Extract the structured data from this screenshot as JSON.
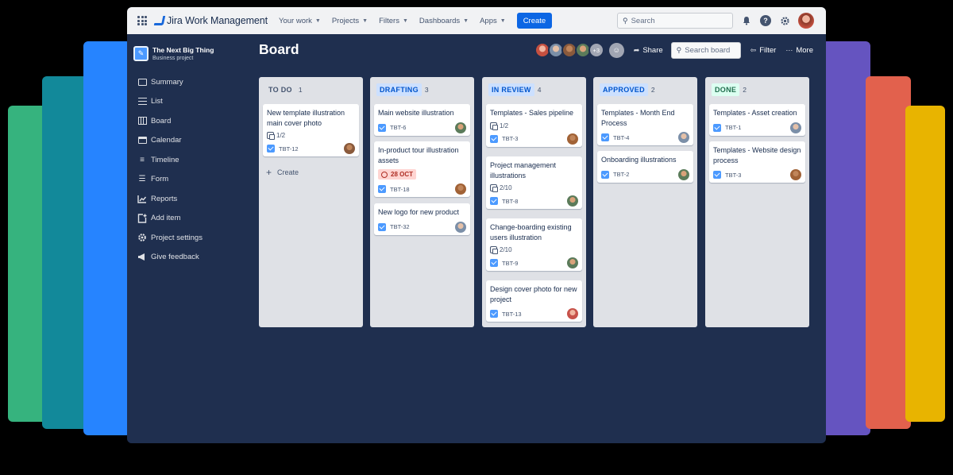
{
  "colors": {
    "stack": [
      "#36b37e",
      "#12899a",
      "#2684ff",
      "#6554c0",
      "#e2614d",
      "#f0502a",
      "#e8b400"
    ],
    "window_bg": "#1f2f4f",
    "accent": "#0c66e4",
    "avatars": [
      "#c55040",
      "#7b8fa8",
      "#8a5a3c",
      "#5b7b5a",
      "#9aa4b5",
      "#a16236",
      "#c7524a"
    ]
  },
  "topnav": {
    "logo_text": "Jira Work Management",
    "menu": [
      {
        "label": "Your work"
      },
      {
        "label": "Projects"
      },
      {
        "label": "Filters"
      },
      {
        "label": "Dashboards"
      },
      {
        "label": "Apps"
      }
    ],
    "create_label": "Create",
    "search_placeholder": "Search",
    "icons": [
      "grid-icon",
      "bell-icon",
      "help-icon",
      "gear-icon"
    ]
  },
  "sidebar": {
    "project_name": "The Next Big Thing",
    "project_type": "Business project",
    "items": [
      {
        "label": "Summary",
        "icon": "summary-icon"
      },
      {
        "label": "List",
        "icon": "list-icon"
      },
      {
        "label": "Board",
        "icon": "board-icon"
      },
      {
        "label": "Calendar",
        "icon": "calendar-icon"
      },
      {
        "label": "Timeline",
        "icon": "timeline-icon"
      },
      {
        "label": "Form",
        "icon": "form-icon"
      },
      {
        "label": "Reports",
        "icon": "reports-icon"
      },
      {
        "label": "Add item",
        "icon": "add-item-icon"
      },
      {
        "label": "Project settings",
        "icon": "gear-icon"
      },
      {
        "label": "Give feedback",
        "icon": "megaphone-icon"
      }
    ]
  },
  "board": {
    "title": "Board",
    "more_members": "+3",
    "share_label": "Share",
    "search_placeholder": "Search board",
    "filter_label": "Filter",
    "more_label": "More",
    "create_label": "Create",
    "columns": [
      {
        "name": "TO DO",
        "count": "1",
        "bg": "#dfe1e6",
        "fg": "#44546f",
        "cards": [
          {
            "title": "New template illustration main cover photo",
            "subtasks": "1/2",
            "key": "TBT-12"
          }
        ]
      },
      {
        "name": "DRAFTING",
        "count": "3",
        "bg": "#cce0ff",
        "fg": "#0055cc",
        "cards": [
          {
            "title": "Main website illustration",
            "key": "TBT-6"
          },
          {
            "title": "In-product tour illustration assets",
            "date": "28 OCT",
            "key": "TBT-18"
          },
          {
            "title": "New logo for new product",
            "key": "TBT-32"
          }
        ]
      },
      {
        "name": "IN REVIEW",
        "count": "4",
        "bg": "#cce0ff",
        "fg": "#0055cc",
        "cards": [
          {
            "title": "Templates - Sales pipeline",
            "subtasks": "1/2",
            "key": "TBT-3"
          },
          {
            "title": "Project management illustrations",
            "subtasks": "2/10",
            "key": "TBT-8"
          },
          {
            "title": "Change-boarding existing users illustration",
            "subtasks": "2/10",
            "key": "TBT-9"
          },
          {
            "title": "Design cover photo for new project",
            "key": "TBT-13"
          }
        ]
      },
      {
        "name": "APPROVED",
        "count": "2",
        "bg": "#cce0ff",
        "fg": "#0055cc",
        "cards": [
          {
            "title": "Templates - Month End Process",
            "key": "TBT-4"
          },
          {
            "title": "Onboarding illustrations",
            "key": "TBT-2"
          }
        ]
      },
      {
        "name": "DONE",
        "count": "2",
        "bg": "#dcfff1",
        "fg": "#216e4e",
        "cards": [
          {
            "title": "Templates - Asset creation",
            "key": "TBT-1"
          },
          {
            "title": "Templates - Website design process",
            "key": "TBT-3"
          }
        ]
      }
    ]
  }
}
